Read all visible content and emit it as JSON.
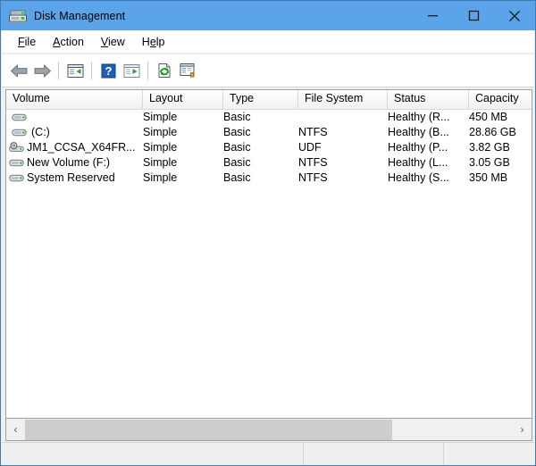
{
  "window": {
    "title": "Disk Management",
    "icon": "disk-drive-icon",
    "titlebar_color": "#5ba4ea",
    "controls": {
      "minimize": "—",
      "maximize": "□",
      "close": "✕"
    }
  },
  "menu": {
    "items": [
      {
        "label": "File",
        "accel": "F"
      },
      {
        "label": "Action",
        "accel": "A"
      },
      {
        "label": "View",
        "accel": "V"
      },
      {
        "label": "Help",
        "accel": "H"
      }
    ]
  },
  "toolbar": {
    "buttons": [
      {
        "name": "back-icon",
        "tip": "Back"
      },
      {
        "name": "forward-icon",
        "tip": "Forward"
      },
      {
        "name": "show-pane-left-icon",
        "tip": "Up One Level"
      },
      {
        "name": "help-icon",
        "tip": "Help"
      },
      {
        "name": "show-pane-right-icon",
        "tip": "Show/Hide Action Pane"
      },
      {
        "name": "refresh-icon",
        "tip": "Refresh"
      },
      {
        "name": "properties-icon",
        "tip": "Properties"
      }
    ]
  },
  "listview": {
    "columns": [
      {
        "key": "volume",
        "label": "Volume",
        "width": 153
      },
      {
        "key": "layout",
        "label": "Layout",
        "width": 90
      },
      {
        "key": "type",
        "label": "Type",
        "width": 84
      },
      {
        "key": "file_system",
        "label": "File System",
        "width": 100
      },
      {
        "key": "status",
        "label": "Status",
        "width": 91
      },
      {
        "key": "capacity",
        "label": "Capacity",
        "width": 70
      }
    ],
    "rows": [
      {
        "icon": "hard-disk-icon",
        "icon_inset": true,
        "volume": "",
        "layout": "Simple",
        "type": "Basic",
        "file_system": "",
        "status": "Healthy (R...",
        "capacity": "450 MB"
      },
      {
        "icon": "hard-disk-icon",
        "icon_inset": true,
        "volume": "(C:)",
        "layout": "Simple",
        "type": "Basic",
        "file_system": "NTFS",
        "status": "Healthy (B...",
        "capacity": "28.86 GB"
      },
      {
        "icon": "optical-disc-drive-icon",
        "icon_inset": false,
        "volume": "JM1_CCSA_X64FR...",
        "layout": "Simple",
        "type": "Basic",
        "file_system": "UDF",
        "status": "Healthy (P...",
        "capacity": "3.82 GB"
      },
      {
        "icon": "hard-disk-icon",
        "icon_inset": false,
        "volume": "New Volume (F:)",
        "layout": "Simple",
        "type": "Basic",
        "file_system": "NTFS",
        "status": "Healthy (L...",
        "capacity": "3.05 GB"
      },
      {
        "icon": "hard-disk-icon",
        "icon_inset": false,
        "volume": "System Reserved",
        "layout": "Simple",
        "type": "Basic",
        "file_system": "NTFS",
        "status": "Healthy (S...",
        "capacity": "350 MB"
      }
    ]
  },
  "scrollbar": {
    "left_arrow": "‹",
    "right_arrow": "›"
  },
  "statusbar": {
    "pane1": "",
    "pane2": "",
    "pane3": ""
  }
}
